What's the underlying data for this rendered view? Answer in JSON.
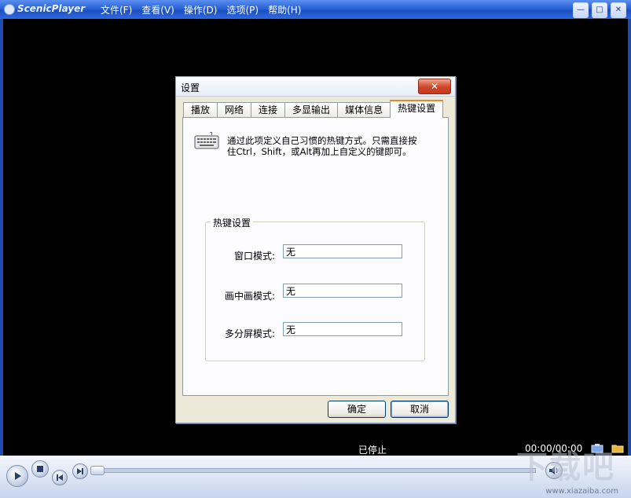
{
  "app": {
    "name": "ScenicPlayer",
    "menu": [
      "文件(F)",
      "查看(V)",
      "操作(D)",
      "选项(P)",
      "帮助(H)"
    ],
    "window_buttons": [
      "minimize",
      "maximize",
      "close"
    ]
  },
  "status": {
    "state": "已停止",
    "time": "00:00/00:00"
  },
  "watermark": {
    "text": "下载吧",
    "url": "www.xiazaiba.com"
  },
  "dialog": {
    "title": "设置",
    "close_label": "✕",
    "tabs": [
      "播放",
      "网络",
      "连接",
      "多显输出",
      "媒体信息",
      "热键设置"
    ],
    "active_tab": "热键设置",
    "description_line1": "通过此项定义自己习惯的热键方式。只需直接按",
    "description_line2": "住Ctrl，Shift，或Alt再加上自定义的键即可。",
    "group_title": "热键设置",
    "fields": [
      {
        "label": "窗口模式:",
        "value": "无"
      },
      {
        "label": "画中画模式:",
        "value": "无"
      },
      {
        "label": "多分屏模式:",
        "value": "无"
      }
    ],
    "ok_label": "确定",
    "cancel_label": "取消"
  },
  "colors": {
    "titlebar": "#2a63d6",
    "video_bg": "#000000",
    "dialog_bg": "#ece9d8",
    "active_tab_accent": "#e68b2c",
    "close_button": "#d0452a"
  }
}
